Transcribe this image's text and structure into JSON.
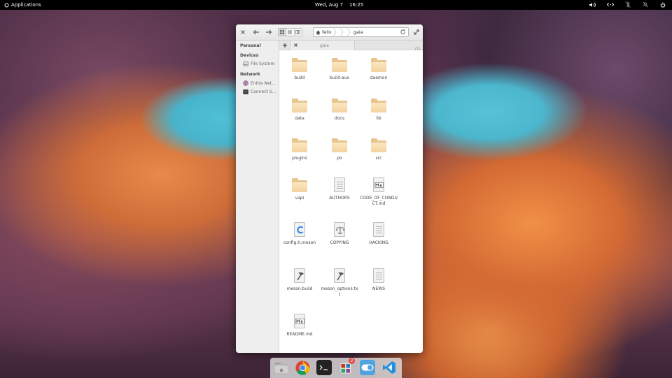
{
  "panel": {
    "applications_label": "Applications",
    "date": "Wed, Aug 7",
    "time": "16:25",
    "indicators": [
      "volume-icon",
      "network-icon",
      "bluetooth-icon",
      "notifications-icon",
      "power-icon"
    ]
  },
  "window": {
    "pathbar": {
      "home_crumb": "felix",
      "current_crumb": "gaia"
    },
    "sidebar": {
      "personal_header": "Personal",
      "devices_header": "Devices",
      "devices": [
        {
          "label": "File System",
          "icon": "drive-icon"
        }
      ],
      "network_header": "Network",
      "network": [
        {
          "label": "Entire Net...",
          "icon": "network-globe-icon"
        },
        {
          "label": "Connect S...",
          "icon": "server-icon"
        }
      ]
    },
    "tabs": {
      "active_label": "gaia"
    },
    "files": [
      {
        "name": "build",
        "kind": "folder"
      },
      {
        "name": "build-aux",
        "kind": "folder"
      },
      {
        "name": "daemon",
        "kind": "folder"
      },
      {
        "name": "data",
        "kind": "folder"
      },
      {
        "name": "docs",
        "kind": "folder"
      },
      {
        "name": "lib",
        "kind": "folder"
      },
      {
        "name": "plugins",
        "kind": "folder"
      },
      {
        "name": "po",
        "kind": "folder"
      },
      {
        "name": "src",
        "kind": "folder"
      },
      {
        "name": "vapi",
        "kind": "folder"
      },
      {
        "name": "AUTHORS",
        "kind": "text"
      },
      {
        "name": "CODE_OF_CONDUCT.md",
        "kind": "markdown"
      },
      {
        "name": "config.h.meson",
        "kind": "c-source"
      },
      {
        "name": "COPYING",
        "kind": "license"
      },
      {
        "name": "HACKING",
        "kind": "text"
      },
      {
        "name": "meson.build",
        "kind": "build"
      },
      {
        "name": "meson_options.txt",
        "kind": "build"
      },
      {
        "name": "NEWS",
        "kind": "text"
      },
      {
        "name": "README.md",
        "kind": "markdown"
      }
    ]
  },
  "dock": {
    "apps": [
      "files-icon",
      "chrome-icon",
      "terminal-icon",
      "app-center-icon",
      "settings-toggle-icon",
      "vscode-icon"
    ],
    "badge": "2"
  },
  "colors": {
    "folder": "#f3d39e",
    "accent": "#3689e6",
    "panel": "#000000"
  }
}
